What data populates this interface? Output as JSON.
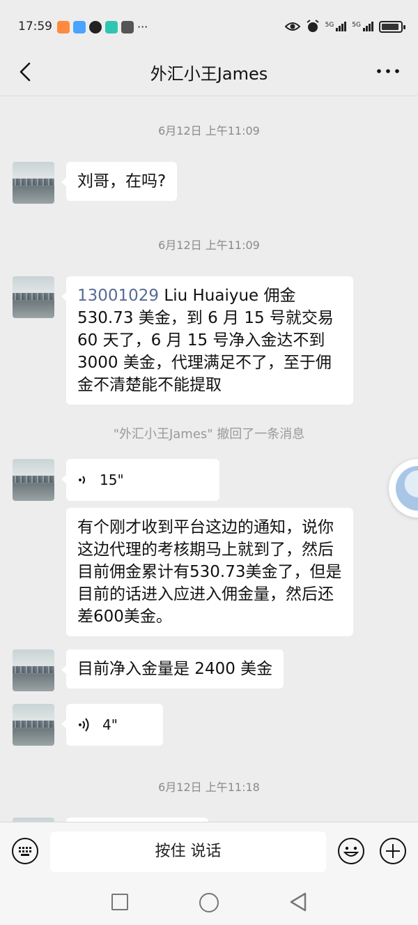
{
  "status_bar": {
    "time": "17:59",
    "more": "···",
    "signal1": "5G",
    "signal2": "5G"
  },
  "header": {
    "title": "外汇小王James"
  },
  "messages": {
    "ts1": "6月12日 上午11:09",
    "m1": "刘哥，在吗?",
    "ts2": "6月12日 上午11:09",
    "m2_number": "13001029",
    "m2_text": " Liu Huaiyue   佣金 530.73 美金，到 6 月 15 号就交易 60 天了，6 月 15 号净入金达不到 3000 美金，代理满足不了，至于佣金不清楚能不能提取",
    "recall": "\"外汇小王James\" 撤回了一条消息",
    "voice1": "15\"",
    "transcript": "有个刚才收到平台这边的通知，说你这边代理的考核期马上就到了，然后目前佣金累计有530.73美金了，但是目前的话进入应进入佣金量，然后还差600美金。",
    "m3": "目前净入金量是 2400 美金",
    "voice2": "4\"",
    "ts3": "6月12日 上午11:18"
  },
  "input_bar": {
    "hold_to_talk": "按住 说话"
  }
}
